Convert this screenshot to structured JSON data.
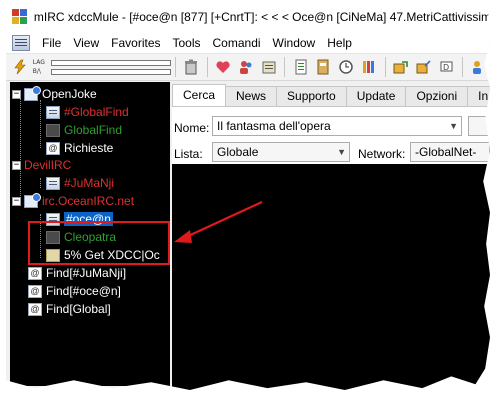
{
  "window": {
    "title": "mIRC xdccMule - [#oce@n [877] [+CnrtT]: < < <  Oce@n [CiNeMa] 47.MetriCattivissimi"
  },
  "menubar": {
    "items": [
      "File",
      "View",
      "Favorites",
      "Tools",
      "Comandi",
      "Window",
      "Help"
    ]
  },
  "toolbar": {
    "lag_label": "LAG",
    "rate_label": "B/\\",
    "lag_level": 0.0,
    "rate_level": 0.0
  },
  "tree": {
    "items": [
      {
        "label": "OpenJoke",
        "color": "#ffffff"
      },
      {
        "label": "#GlobalFind",
        "color": "#e03030"
      },
      {
        "label": "GlobalFind",
        "color": "#2ea02e"
      },
      {
        "label": "Richieste",
        "color": "#ffffff"
      },
      {
        "label": "DevilIRC",
        "color": "#e03030"
      },
      {
        "label": "#JuMaNji",
        "color": "#e03030"
      },
      {
        "label": "irc.OceanIRC.net",
        "color": "#e03030"
      },
      {
        "label": "#oce@n",
        "color": "#ffffff"
      },
      {
        "label": "Cleopatra",
        "color": "#2ea02e"
      },
      {
        "label": "5% Get XDCC|Oc",
        "color": "#ffffff"
      },
      {
        "label": "Find[#JuMaNji]",
        "color": "#ffffff"
      },
      {
        "label": "Find[#oce@n]",
        "color": "#ffffff"
      },
      {
        "label": "Find[Global]",
        "color": "#ffffff"
      }
    ]
  },
  "tabs": {
    "items": [
      "Cerca",
      "News",
      "Supporto",
      "Update",
      "Opzioni",
      "In"
    ],
    "active": "Cerca"
  },
  "search": {
    "name_label": "Nome:",
    "name_value": "Il fantasma dell'opera",
    "list_label": "Lista:",
    "list_value": "Globale",
    "network_label": "Network:",
    "network_value": "-GlobalNet-"
  },
  "colors": {
    "highlight": "#e01a1a",
    "selection": "#0a64c8"
  }
}
